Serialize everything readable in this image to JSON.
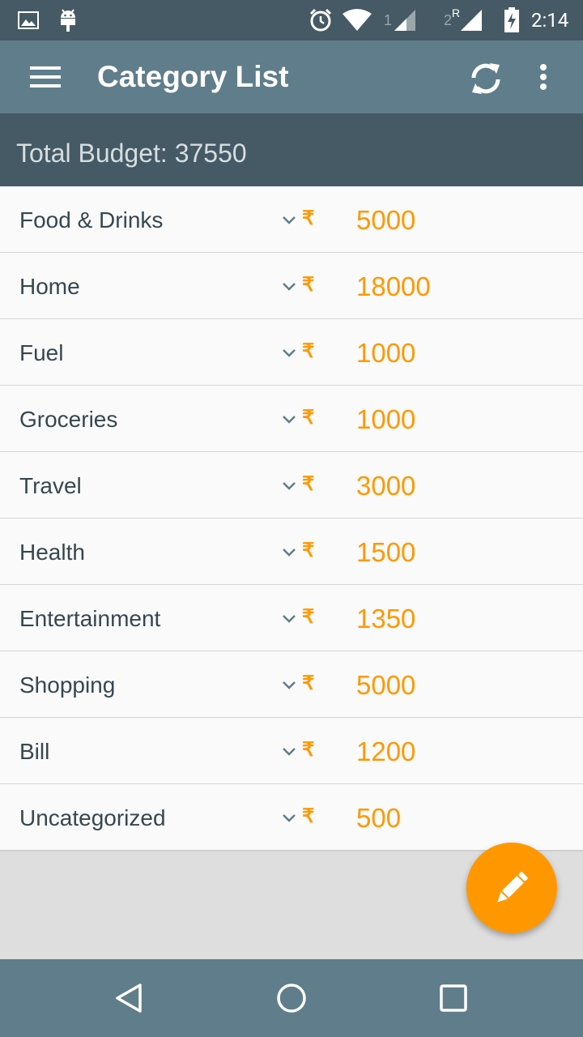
{
  "status_bar": {
    "time": "2:14",
    "icons": [
      "image-icon",
      "android-icon",
      "alarm-icon",
      "wifi-icon",
      "signal-1-icon",
      "signal-2-roaming-icon",
      "battery-charging-icon"
    ],
    "sim1_label": "1",
    "sim2_label": "2",
    "roaming_label": "R"
  },
  "app_bar": {
    "title": "Category List",
    "icons": [
      "menu-icon",
      "sync-icon",
      "more-vert-icon"
    ]
  },
  "budget": {
    "label": "Total Budget: 37550"
  },
  "currency_symbol": "₹",
  "categories": [
    {
      "name": "Food & Drinks",
      "amount": "5000"
    },
    {
      "name": "Home",
      "amount": "18000"
    },
    {
      "name": "Fuel",
      "amount": "1000"
    },
    {
      "name": "Groceries",
      "amount": "1000"
    },
    {
      "name": "Travel",
      "amount": "3000"
    },
    {
      "name": "Health",
      "amount": "1500"
    },
    {
      "name": "Entertainment",
      "amount": "1350"
    },
    {
      "name": "Shopping",
      "amount": "5000"
    },
    {
      "name": "Bill",
      "amount": "1200"
    },
    {
      "name": "Uncategorized",
      "amount": "500"
    }
  ],
  "fab": {
    "icon": "pencil-icon"
  },
  "nav_bar": {
    "icons": [
      "back-icon",
      "home-icon",
      "recents-icon"
    ]
  },
  "colors": {
    "status_bar": "#455a64",
    "app_bar": "#607d8b",
    "budget_bar": "#455a64",
    "accent": "#ff9800",
    "text": "#37474f"
  }
}
